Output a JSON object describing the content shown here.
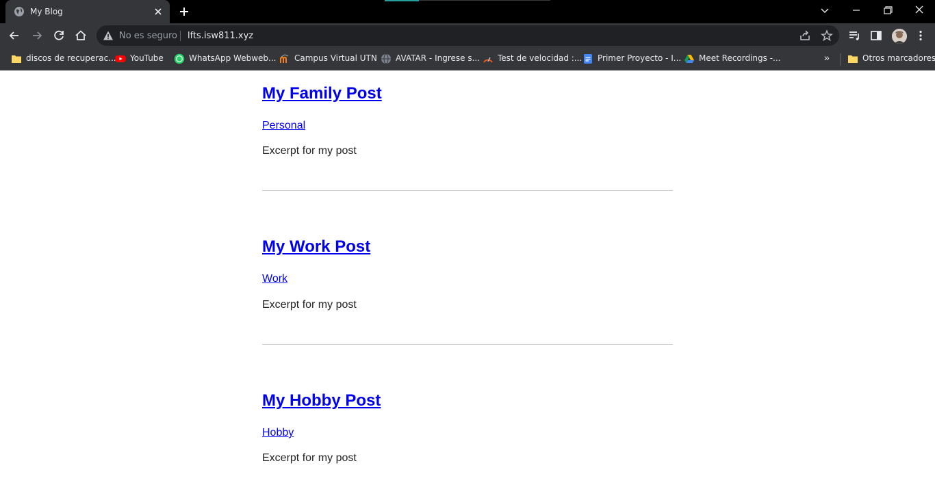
{
  "browser": {
    "tab": {
      "title": "My Blog"
    },
    "omnibox": {
      "security_text": "No es seguro",
      "url": "lfts.isw811.xyz"
    },
    "bookmarks": [
      {
        "label": "discos de recuperac...",
        "icon": "folder-icon"
      },
      {
        "label": "YouTube",
        "icon": "youtube-icon"
      },
      {
        "label": "WhatsApp Webweb...",
        "icon": "whatsapp-icon"
      },
      {
        "label": "Campus Virtual UTN",
        "icon": "moodle-icon"
      },
      {
        "label": "AVATAR - Ingrese s...",
        "icon": "globe-icon"
      },
      {
        "label": "Test de velocidad :...",
        "icon": "speedometer-icon"
      },
      {
        "label": "Primer Proyecto - I...",
        "icon": "docs-icon"
      },
      {
        "label": "Meet Recordings -...",
        "icon": "drive-icon"
      }
    ],
    "bookmarks_more": "»",
    "other_bookmarks": "Otros marcadores"
  },
  "posts": [
    {
      "title": "My Family Post",
      "category": "Personal",
      "excerpt": "Excerpt for my post"
    },
    {
      "title": "My Work Post",
      "category": "Work",
      "excerpt": "Excerpt for my post"
    },
    {
      "title": "My Hobby Post",
      "category": "Hobby",
      "excerpt": "Excerpt for my post"
    }
  ],
  "colors": {
    "link": "#0000ee",
    "chrome_dark": "#35363a",
    "tabstrip": "#000000",
    "omnibox": "#202124"
  }
}
